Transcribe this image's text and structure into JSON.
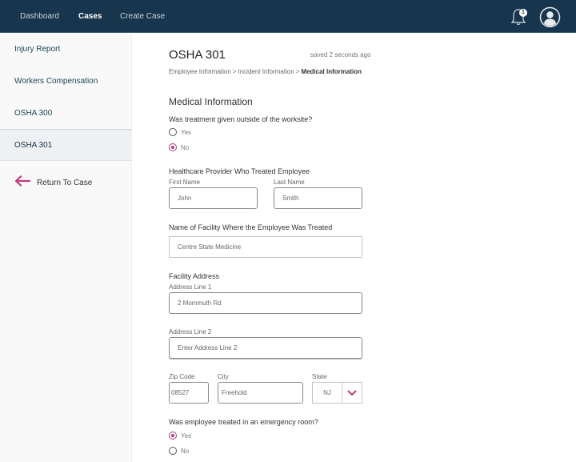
{
  "topbar": {
    "nav": [
      {
        "label": "Dashboard",
        "active": false
      },
      {
        "label": "Cases",
        "active": true
      },
      {
        "label": "Create Case",
        "active": false
      }
    ],
    "notifications_count": "1",
    "icons": {
      "bell": "bell-icon",
      "avatar": "user-avatar-icon"
    }
  },
  "sidebar": {
    "items": [
      {
        "label": "Injury Report"
      },
      {
        "label": "Workers Compensation"
      },
      {
        "label": "OSHA 300"
      },
      {
        "label": "OSHA 301",
        "active": true
      }
    ],
    "return_label": "Return To Case",
    "return_icon": "arrow-left-icon"
  },
  "page": {
    "title": "OSHA 301",
    "saved_status": "saved 2 seconds ago",
    "breadcrumb": [
      "Employee Information",
      "Incident Information",
      "Medical Information"
    ],
    "breadcrumb_separator": ">",
    "section_title": "Medical Information"
  },
  "form": {
    "q_outside": {
      "label": "Was treatment given outside of the worksite?",
      "options": [
        "Yes",
        "No"
      ],
      "selected": "No"
    },
    "provider": {
      "label": "Healthcare Provider Who Treated Employee",
      "first_name_label": "First Name",
      "first_name_value": "John",
      "last_name_label": "Last Name",
      "last_name_value": "Smith"
    },
    "facility": {
      "label": "Name of Facility Where the Employee Was Treated",
      "value": "Centre State Medicine"
    },
    "address": {
      "label": "Facility Address",
      "line1_label": "Address Line 1",
      "line1_value": "2 Mommuth Rd",
      "line2_label": "Address Line 2",
      "line2_placeholder": "Enter Address Line 2",
      "zip_label": "Zip Code",
      "zip_value": "08527",
      "city_label": "City",
      "city_value": "Freehold",
      "state_label": "State",
      "state_value": "NJ"
    },
    "q_er": {
      "label": "Was employee treated in an emergency room?",
      "options": [
        "Yes",
        "No"
      ],
      "selected": "Yes"
    }
  },
  "colors": {
    "topbar_bg": "#17364d",
    "accent": "#c13a7c",
    "sidebar_bg": "#f9f9f9",
    "sidebar_active_bg": "#eef1f3"
  }
}
